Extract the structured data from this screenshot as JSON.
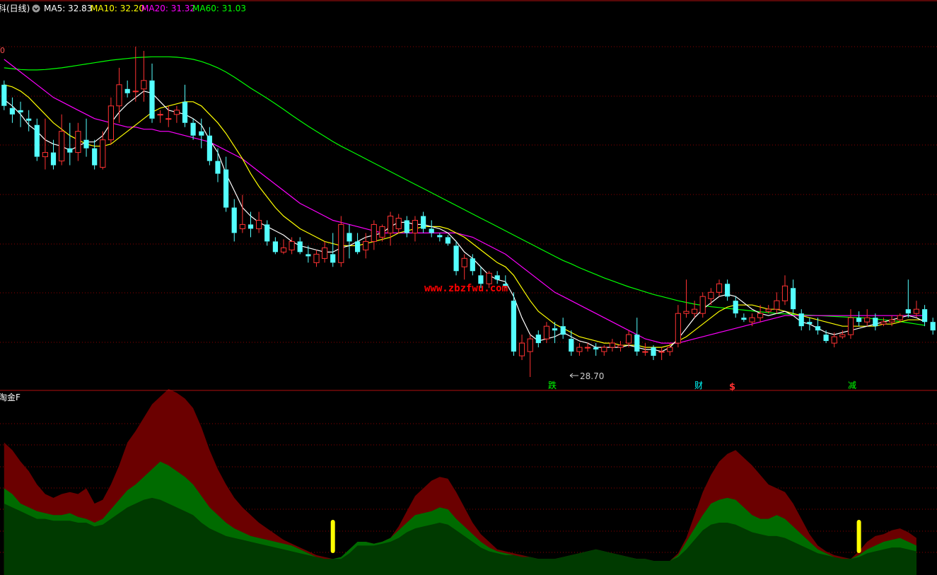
{
  "header": {
    "title": "科(日线)",
    "ma": [
      {
        "label": "MA5: 32.83",
        "color": "#ffffff"
      },
      {
        "label": "MA10: 32.20",
        "color": "#ffff00"
      },
      {
        "label": "MA20: 31.32",
        "color": "#ff00ff"
      },
      {
        "label": "MA60: 31.03",
        "color": "#00ff00"
      }
    ],
    "menu_icon": "chevron-down-icon"
  },
  "price_axis_fragment": "0",
  "low_marker": "28.70",
  "watermark": "www.zbzfwu.com",
  "signals": [
    {
      "text": "跌",
      "color": "#00ff00"
    },
    {
      "text": "财",
      "color": "#00ffff"
    },
    {
      "text": "$",
      "color": "#ff3030"
    },
    {
      "text": "减",
      "color": "#00ff00"
    }
  ],
  "indicator": {
    "title": "淘金F"
  },
  "colors": {
    "up": "#ff3232",
    "down": "#54ffff",
    "ma5": "#ffffff",
    "ma10": "#ffff00",
    "ma20": "#ff00ff",
    "ma60": "#00ff00",
    "grid": "#8b0000",
    "area_top": "#6b0000",
    "area_mid": "#006b00",
    "area_low": "#003a00",
    "bar": "#ffff00"
  },
  "chart_data": {
    "type": "candlestick",
    "candles": [
      [
        33.9,
        33.4,
        34.0,
        33.3
      ],
      [
        33.35,
        33.2,
        33.6,
        33.0
      ],
      [
        33.3,
        33.25,
        33.5,
        32.9
      ],
      [
        33.1,
        33.05,
        33.3,
        32.8
      ],
      [
        32.95,
        32.2,
        33.1,
        32.1
      ],
      [
        32.2,
        32.3,
        33.1,
        31.9
      ],
      [
        32.3,
        32.0,
        32.6,
        31.9
      ],
      [
        32.1,
        32.8,
        33.2,
        32.0
      ],
      [
        32.4,
        32.3,
        33.0,
        32.0
      ],
      [
        32.3,
        32.8,
        33.0,
        32.1
      ],
      [
        32.6,
        32.4,
        33.1,
        32.2
      ],
      [
        32.4,
        32.0,
        32.6,
        31.9
      ],
      [
        31.95,
        32.6,
        32.8,
        31.9
      ],
      [
        32.6,
        33.4,
        33.6,
        32.5
      ],
      [
        33.4,
        33.9,
        34.3,
        33.0
      ],
      [
        33.8,
        33.7,
        34.0,
        33.6
      ],
      [
        33.75,
        33.75,
        34.8,
        33.5
      ],
      [
        33.8,
        34.0,
        34.7,
        33.5
      ],
      [
        34.0,
        33.1,
        34.4,
        33.0
      ],
      [
        33.2,
        33.2,
        33.3,
        33.0
      ],
      [
        33.1,
        33.1,
        33.4,
        32.9
      ],
      [
        33.2,
        33.3,
        33.4,
        33.0
      ],
      [
        33.5,
        33.0,
        33.9,
        32.9
      ],
      [
        33.0,
        32.7,
        33.1,
        32.6
      ],
      [
        32.8,
        32.7,
        33.1,
        32.4
      ],
      [
        32.7,
        32.1,
        32.9,
        32.0
      ],
      [
        32.1,
        31.8,
        32.4,
        31.6
      ],
      [
        31.9,
        31.0,
        32.2,
        30.9
      ],
      [
        31.0,
        30.4,
        31.2,
        30.2
      ],
      [
        30.5,
        30.6,
        31.3,
        30.4
      ],
      [
        30.6,
        30.5,
        30.9,
        30.3
      ],
      [
        30.5,
        30.7,
        30.9,
        30.4
      ],
      [
        30.6,
        30.2,
        30.7,
        30.1
      ],
      [
        30.2,
        29.95,
        30.3,
        29.9
      ],
      [
        29.95,
        30.05,
        30.25,
        29.9
      ],
      [
        30.0,
        30.2,
        30.3,
        29.9
      ],
      [
        30.2,
        29.95,
        30.3,
        29.9
      ],
      [
        29.9,
        29.85,
        30.1,
        29.7
      ],
      [
        29.7,
        29.9,
        30.0,
        29.6
      ],
      [
        29.8,
        30.05,
        30.2,
        29.7
      ],
      [
        29.9,
        29.7,
        30.4,
        29.6
      ],
      [
        29.7,
        30.6,
        30.8,
        29.6
      ],
      [
        30.4,
        30.2,
        30.6,
        29.8
      ],
      [
        30.2,
        29.95,
        30.4,
        29.9
      ],
      [
        30.0,
        30.2,
        30.4,
        29.8
      ],
      [
        30.2,
        30.6,
        30.7,
        30.0
      ],
      [
        30.3,
        30.55,
        30.6,
        30.2
      ],
      [
        30.4,
        30.8,
        30.9,
        30.1
      ],
      [
        30.5,
        30.75,
        30.85,
        30.4
      ],
      [
        30.7,
        30.4,
        30.8,
        30.3
      ],
      [
        30.4,
        30.7,
        30.8,
        30.2
      ],
      [
        30.8,
        30.5,
        30.9,
        30.4
      ],
      [
        30.5,
        30.4,
        30.7,
        30.3
      ],
      [
        30.35,
        30.3,
        30.4,
        30.2
      ],
      [
        30.3,
        30.15,
        30.35,
        30.1
      ],
      [
        30.1,
        29.5,
        30.2,
        29.4
      ],
      [
        29.6,
        29.8,
        29.9,
        29.3
      ],
      [
        29.8,
        29.5,
        29.9,
        29.4
      ],
      [
        29.4,
        29.2,
        29.6,
        29.1
      ],
      [
        29.2,
        29.45,
        29.5,
        29.1
      ],
      [
        29.4,
        29.3,
        29.5,
        29.2
      ],
      [
        29.2,
        29.15,
        29.4,
        29.1
      ],
      [
        28.8,
        27.6,
        29.0,
        27.5
      ],
      [
        27.5,
        27.8,
        28.0,
        27.4
      ],
      [
        27.6,
        27.9,
        28.0,
        27.0
      ],
      [
        28.0,
        27.8,
        28.1,
        27.7
      ],
      [
        27.9,
        28.2,
        28.3,
        27.8
      ],
      [
        28.15,
        28.1,
        28.3,
        27.8
      ],
      [
        28.2,
        28.0,
        28.4,
        27.9
      ],
      [
        27.9,
        27.6,
        28.1,
        27.5
      ],
      [
        27.6,
        27.7,
        27.8,
        27.5
      ],
      [
        27.7,
        27.7,
        27.8,
        27.6
      ],
      [
        27.7,
        27.65,
        27.8,
        27.5
      ],
      [
        27.6,
        27.7,
        27.75,
        27.5
      ],
      [
        27.7,
        27.8,
        27.9,
        27.6
      ],
      [
        27.7,
        27.75,
        27.85,
        27.6
      ],
      [
        27.8,
        28.0,
        28.1,
        27.7
      ],
      [
        28.0,
        27.6,
        28.4,
        27.5
      ],
      [
        27.6,
        27.6,
        27.8,
        27.5
      ],
      [
        27.7,
        27.5,
        27.75,
        27.4
      ],
      [
        27.6,
        27.6,
        27.7,
        27.4
      ],
      [
        27.6,
        27.7,
        27.8,
        27.5
      ],
      [
        27.8,
        28.5,
        28.7,
        27.7
      ],
      [
        28.5,
        28.55,
        29.3,
        28.4
      ],
      [
        28.5,
        28.6,
        28.8,
        28.4
      ],
      [
        28.5,
        28.9,
        29.0,
        28.4
      ],
      [
        28.85,
        29.0,
        29.1,
        28.7
      ],
      [
        29.0,
        29.2,
        29.3,
        28.9
      ],
      [
        29.2,
        28.9,
        29.3,
        28.8
      ],
      [
        28.8,
        28.5,
        28.9,
        28.4
      ],
      [
        28.4,
        28.35,
        28.5,
        28.3
      ],
      [
        28.3,
        28.4,
        28.5,
        28.2
      ],
      [
        28.4,
        28.5,
        28.7,
        28.3
      ],
      [
        28.55,
        28.6,
        28.7,
        28.5
      ],
      [
        28.6,
        28.8,
        29.0,
        28.5
      ],
      [
        28.8,
        29.15,
        29.4,
        28.7
      ],
      [
        29.1,
        28.6,
        29.3,
        28.5
      ],
      [
        28.5,
        28.2,
        28.6,
        28.1
      ],
      [
        28.3,
        28.25,
        28.4,
        28.1
      ],
      [
        28.2,
        28.1,
        28.4,
        28.0
      ],
      [
        28.0,
        27.85,
        28.1,
        27.8
      ],
      [
        27.8,
        27.95,
        28.05,
        27.7
      ],
      [
        27.95,
        28.0,
        28.1,
        27.9
      ],
      [
        28.0,
        28.4,
        28.6,
        27.9
      ],
      [
        28.4,
        28.3,
        28.55,
        28.2
      ],
      [
        28.3,
        28.4,
        28.6,
        28.2
      ],
      [
        28.4,
        28.2,
        28.5,
        28.1
      ],
      [
        28.25,
        28.3,
        28.4,
        28.2
      ],
      [
        28.3,
        28.35,
        28.45,
        28.2
      ],
      [
        28.35,
        28.45,
        28.5,
        28.3
      ],
      [
        28.6,
        28.5,
        29.3,
        28.4
      ],
      [
        28.5,
        28.6,
        28.8,
        28.4
      ],
      [
        28.6,
        28.3,
        28.7,
        28.2
      ],
      [
        28.3,
        28.1,
        28.4,
        28.0
      ]
    ],
    "ma5": [
      33.55,
      33.4,
      33.2,
      32.95,
      32.8,
      32.6,
      32.5,
      32.45,
      32.35,
      32.45,
      32.55,
      32.55,
      32.7,
      33.0,
      33.25,
      33.45,
      33.6,
      33.75,
      33.7,
      33.5,
      33.3,
      33.25,
      33.2,
      33.1,
      32.95,
      32.6,
      32.3,
      31.8,
      31.4,
      31.0,
      30.8,
      30.65,
      30.55,
      30.45,
      30.35,
      30.2,
      30.1,
      30.05,
      30.0,
      29.95,
      29.95,
      30.05,
      30.1,
      30.2,
      30.3,
      30.35,
      30.4,
      30.55,
      30.65,
      30.65,
      30.6,
      30.6,
      30.55,
      30.5,
      30.4,
      30.2,
      29.95,
      29.8,
      29.6,
      29.4,
      29.3,
      29.25,
      28.9,
      28.4,
      28.0,
      27.85,
      27.9,
      27.95,
      28.05,
      27.95,
      27.85,
      27.8,
      27.7,
      27.7,
      27.7,
      27.7,
      27.75,
      27.7,
      27.65,
      27.65,
      27.6,
      27.7,
      27.9,
      28.15,
      28.4,
      28.6,
      28.75,
      28.9,
      28.95,
      28.9,
      28.75,
      28.6,
      28.5,
      28.45,
      28.5,
      28.55,
      28.45,
      28.3,
      28.25,
      28.15,
      28.05,
      28.0,
      28.05,
      28.1,
      28.15,
      28.2,
      28.25,
      28.3,
      28.35,
      28.4,
      28.45,
      28.4,
      28.3
    ],
    "ma10": [
      33.9,
      33.85,
      33.75,
      33.6,
      33.4,
      33.2,
      33.0,
      32.85,
      32.7,
      32.6,
      32.5,
      32.45,
      32.45,
      32.5,
      32.65,
      32.8,
      32.95,
      33.1,
      33.25,
      33.35,
      33.4,
      33.45,
      33.5,
      33.5,
      33.4,
      33.2,
      33.0,
      32.75,
      32.45,
      32.15,
      31.8,
      31.5,
      31.25,
      31.0,
      30.8,
      30.65,
      30.5,
      30.4,
      30.3,
      30.2,
      30.15,
      30.1,
      30.1,
      30.1,
      30.15,
      30.2,
      30.25,
      30.3,
      30.4,
      30.45,
      30.5,
      30.55,
      30.55,
      30.55,
      30.5,
      30.4,
      30.3,
      30.15,
      30.0,
      29.85,
      29.7,
      29.6,
      29.4,
      29.1,
      28.8,
      28.55,
      28.4,
      28.25,
      28.15,
      28.05,
      27.95,
      27.9,
      27.85,
      27.8,
      27.8,
      27.75,
      27.75,
      27.75,
      27.7,
      27.7,
      27.7,
      27.75,
      27.85,
      27.95,
      28.1,
      28.25,
      28.4,
      28.55,
      28.65,
      28.7,
      28.7,
      28.7,
      28.65,
      28.6,
      28.6,
      28.55,
      28.5,
      28.45,
      28.4,
      28.35,
      28.3,
      28.25,
      28.2,
      28.2,
      28.2,
      28.2,
      28.2,
      28.25,
      28.25,
      28.3,
      28.35,
      28.35,
      28.35
    ],
    "ma20": [
      34.5,
      34.35,
      34.2,
      34.05,
      33.9,
      33.75,
      33.6,
      33.5,
      33.4,
      33.3,
      33.2,
      33.1,
      33.05,
      33.0,
      32.95,
      32.9,
      32.9,
      32.85,
      32.85,
      32.8,
      32.8,
      32.75,
      32.7,
      32.65,
      32.6,
      32.55,
      32.45,
      32.35,
      32.25,
      32.15,
      32.0,
      31.85,
      31.7,
      31.55,
      31.4,
      31.25,
      31.1,
      31.0,
      30.9,
      30.8,
      30.7,
      30.65,
      30.6,
      30.55,
      30.5,
      30.45,
      30.4,
      30.4,
      30.4,
      30.4,
      30.4,
      30.4,
      30.4,
      30.4,
      30.4,
      30.4,
      30.35,
      30.3,
      30.2,
      30.1,
      30.0,
      29.9,
      29.75,
      29.6,
      29.45,
      29.3,
      29.15,
      29.0,
      28.9,
      28.8,
      28.7,
      28.6,
      28.5,
      28.4,
      28.3,
      28.2,
      28.1,
      28.0,
      27.9,
      27.85,
      27.8,
      27.8,
      27.8,
      27.85,
      27.9,
      27.95,
      28.0,
      28.05,
      28.1,
      28.15,
      28.2,
      28.25,
      28.3,
      28.35,
      28.4,
      28.45,
      28.45,
      28.45,
      28.45,
      28.45,
      28.45,
      28.45,
      28.45,
      28.45,
      28.45,
      28.45,
      28.45,
      28.45,
      28.45,
      28.45,
      28.45,
      28.45,
      28.45
    ],
    "ma60": [
      34.3,
      34.28,
      34.26,
      34.25,
      34.25,
      34.26,
      34.28,
      34.3,
      34.33,
      34.36,
      34.39,
      34.42,
      34.45,
      34.48,
      34.5,
      34.52,
      34.54,
      34.55,
      34.56,
      34.56,
      34.56,
      34.55,
      34.53,
      34.5,
      34.45,
      34.38,
      34.3,
      34.2,
      34.08,
      33.95,
      33.82,
      33.7,
      33.58,
      33.45,
      33.32,
      33.18,
      33.05,
      32.92,
      32.8,
      32.68,
      32.56,
      32.45,
      32.35,
      32.25,
      32.15,
      32.05,
      31.95,
      31.85,
      31.75,
      31.65,
      31.55,
      31.45,
      31.35,
      31.25,
      31.15,
      31.05,
      30.95,
      30.85,
      30.75,
      30.65,
      30.55,
      30.45,
      30.35,
      30.25,
      30.15,
      30.05,
      29.95,
      29.85,
      29.75,
      29.67,
      29.58,
      29.5,
      29.42,
      29.34,
      29.27,
      29.2,
      29.13,
      29.07,
      29.01,
      28.95,
      28.9,
      28.85,
      28.8,
      28.76,
      28.72,
      28.69,
      28.66,
      28.64,
      28.62,
      28.6,
      28.58,
      28.56,
      28.54,
      28.52,
      28.5,
      28.49,
      28.48,
      28.47,
      28.46,
      28.45,
      28.44,
      28.43,
      28.42,
      28.41,
      28.4,
      28.39,
      28.37,
      28.35,
      28.33,
      28.31,
      28.28,
      28.25,
      28.22
    ],
    "indicator": {
      "upper": [
        62,
        58,
        52,
        47,
        40,
        35,
        33,
        35,
        36,
        35,
        38,
        30,
        32,
        40,
        50,
        62,
        68,
        75,
        82,
        86,
        90,
        88,
        85,
        80,
        70,
        58,
        48,
        40,
        33,
        28,
        24,
        20,
        17,
        14,
        11,
        9,
        7,
        5,
        3,
        2,
        1,
        0,
        3,
        8,
        10,
        9,
        10,
        12,
        18,
        26,
        34,
        38,
        42,
        44,
        43,
        36,
        28,
        20,
        14,
        10,
        6,
        5,
        4,
        3,
        2,
        1,
        0,
        1,
        2,
        3,
        4,
        5,
        6,
        5,
        4,
        3,
        2,
        1,
        1,
        0,
        0,
        0,
        4,
        12,
        24,
        36,
        45,
        52,
        56,
        58,
        54,
        50,
        45,
        40,
        38,
        36,
        30,
        22,
        14,
        8,
        5,
        3,
        2,
        1,
        5,
        10,
        13,
        14,
        16,
        17,
        15,
        12
      ],
      "middle": [
        38,
        35,
        30,
        28,
        26,
        25,
        24,
        24,
        25,
        23,
        22,
        20,
        22,
        27,
        32,
        37,
        40,
        44,
        48,
        52,
        50,
        47,
        44,
        40,
        34,
        28,
        24,
        20,
        17,
        15,
        13,
        12,
        11,
        10,
        9,
        8,
        6,
        4,
        2,
        1,
        1,
        2,
        6,
        10,
        10,
        9,
        10,
        12,
        16,
        20,
        24,
        25,
        26,
        28,
        27,
        22,
        18,
        14,
        10,
        7,
        5,
        4,
        3,
        2,
        2,
        1,
        1,
        1,
        2,
        3,
        4,
        5,
        6,
        5,
        4,
        3,
        2,
        1,
        1,
        0,
        0,
        0,
        3,
        10,
        17,
        24,
        30,
        32,
        33,
        32,
        28,
        24,
        22,
        22,
        24,
        22,
        18,
        14,
        10,
        6,
        4,
        2,
        1,
        1,
        3,
        6,
        8,
        10,
        11,
        12,
        10,
        8
      ],
      "lower": [
        30,
        28,
        26,
        24,
        22,
        22,
        21,
        21,
        21,
        20,
        20,
        18,
        19,
        22,
        25,
        28,
        30,
        32,
        33,
        32,
        30,
        28,
        26,
        24,
        20,
        17,
        15,
        13,
        12,
        11,
        10,
        9,
        8,
        7,
        6,
        5,
        4,
        3,
        2,
        1,
        1,
        1,
        4,
        8,
        8,
        8,
        9,
        10,
        12,
        15,
        17,
        18,
        19,
        20,
        19,
        16,
        13,
        10,
        7,
        5,
        4,
        3,
        3,
        2,
        2,
        1,
        1,
        1,
        2,
        3,
        4,
        5,
        6,
        5,
        4,
        3,
        2,
        1,
        1,
        0,
        0,
        0,
        2,
        6,
        11,
        16,
        19,
        20,
        20,
        19,
        17,
        15,
        14,
        13,
        13,
        12,
        10,
        8,
        6,
        4,
        3,
        2,
        1,
        1,
        2,
        4,
        5,
        6,
        7,
        7,
        6,
        5
      ],
      "markers": [
        40,
        104
      ]
    }
  }
}
